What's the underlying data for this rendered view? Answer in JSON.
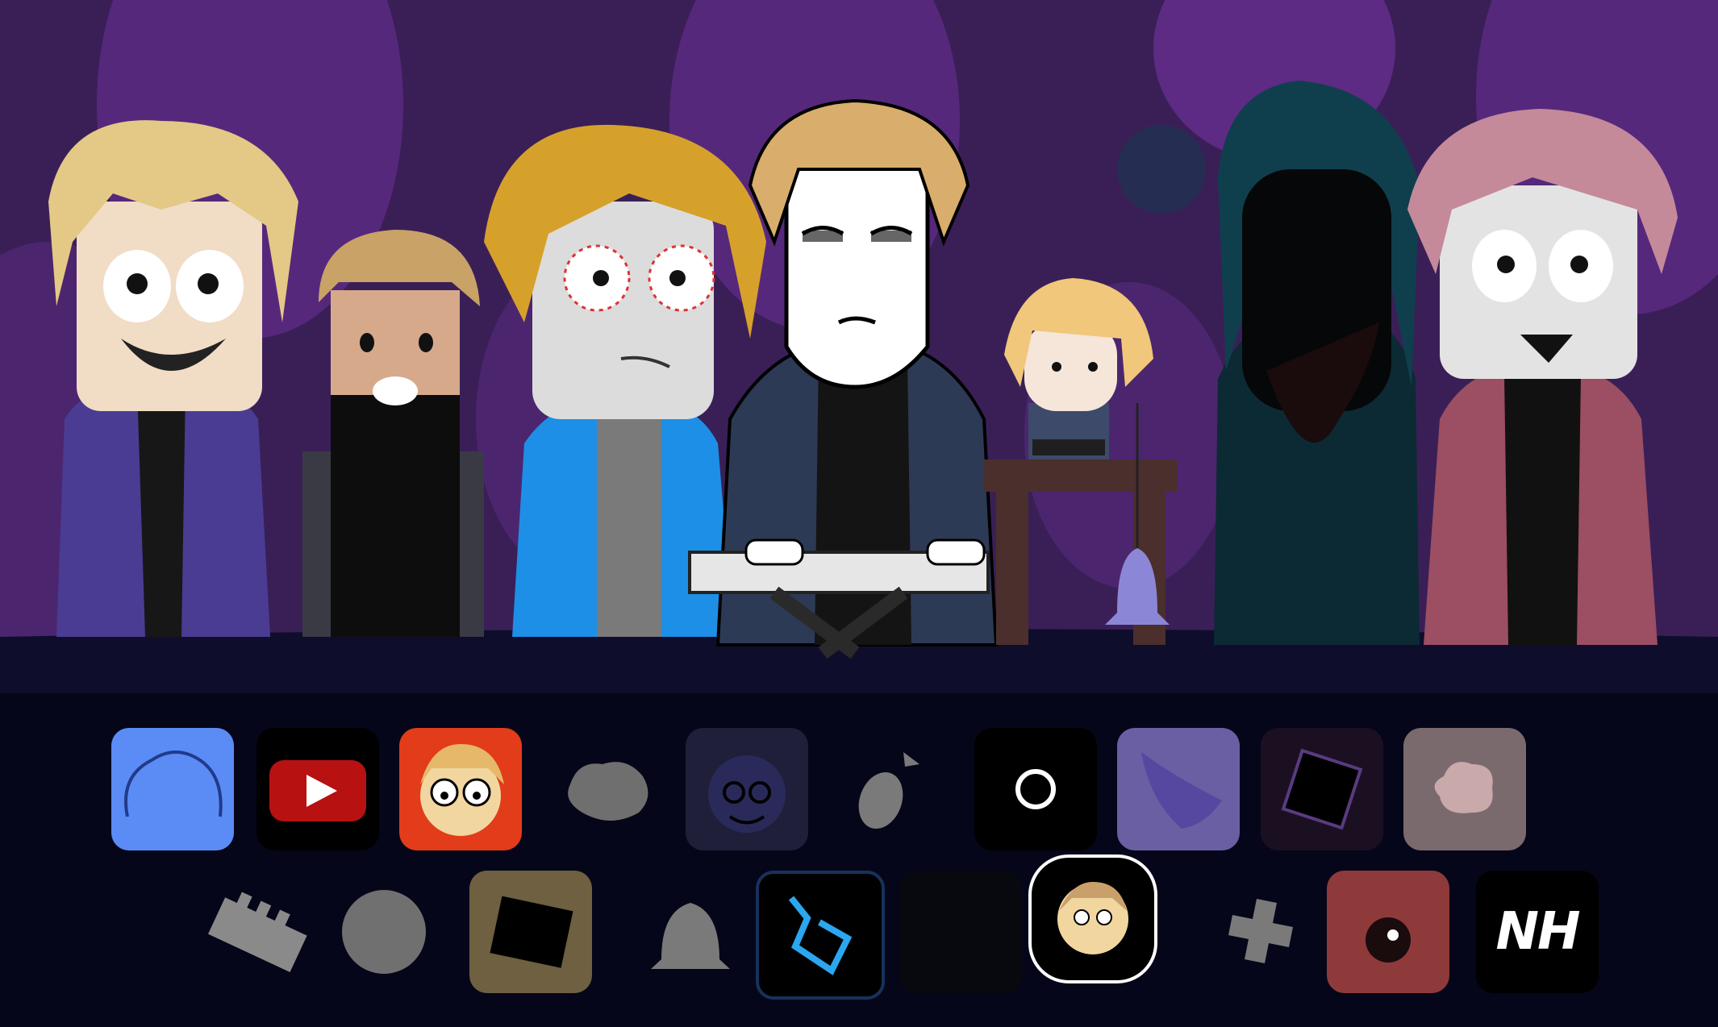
{
  "scene": {
    "background_color": "#3a1f57",
    "stage_floor_color": "#0e0e2c",
    "icon_tray_color": "#06061a",
    "characters": [
      {
        "name": "blonde-purple-coat-character",
        "hair": "#e3c985",
        "coat": "#4a3c93"
      },
      {
        "name": "blocky-brown-hair-character",
        "hair": "#c8a266",
        "coat": "#2c2c34"
      },
      {
        "name": "stitched-eyes-character",
        "hair": "#d6a12b",
        "coat": "#1e8fe6"
      },
      {
        "name": "tired-hoodie-keyboard-character",
        "hair": "#d9ad6b",
        "coat": "#2d3a55"
      },
      {
        "name": "small-bell-ringer-character",
        "hair": "#f0c77b",
        "coat": "#3d4a6a"
      },
      {
        "name": "shadow-teal-character",
        "hair": "#0f3f4d",
        "coat": "#0c2a33"
      },
      {
        "name": "pink-hair-character",
        "hair": "#c48a9a",
        "coat": "#9c4e62"
      }
    ]
  },
  "sound_icons": {
    "row1": [
      {
        "name": "blue-hair-sound-icon",
        "bg": "#5b8cf5"
      },
      {
        "name": "youtube-play-sound-icon",
        "bg": "#000000"
      },
      {
        "name": "cartoon-face-sound-icon",
        "bg": "#e23c1a"
      },
      {
        "name": "gray-bush-sound-icon",
        "bg": "transparent"
      },
      {
        "name": "dark-face-sound-icon",
        "bg": "#1f1f3a"
      },
      {
        "name": "seed-sound-icon",
        "bg": "transparent"
      },
      {
        "name": "circle-sound-icon",
        "bg": "#000000"
      },
      {
        "name": "purple-shape-sound-icon",
        "bg": "#6a5fa3"
      },
      {
        "name": "dark-square-sound-icon",
        "bg": "#1a1022"
      },
      {
        "name": "pink-blob-sound-icon",
        "bg": "#7a6a6e"
      }
    ],
    "row2": [
      {
        "name": "piano-keys-sound-icon",
        "bg": "transparent"
      },
      {
        "name": "spiky-ball-sound-icon",
        "bg": "transparent"
      },
      {
        "name": "tilted-square-sound-icon",
        "bg": "#6e6040"
      },
      {
        "name": "bell-sound-icon",
        "bg": "transparent"
      },
      {
        "name": "blue-scribble-sound-icon",
        "bg": "#000000"
      },
      {
        "name": "empty-sound-icon",
        "bg": "#08080f"
      },
      {
        "name": "portrait-frame-sound-icon",
        "bg": "#000000"
      },
      {
        "name": "cross-sound-icon",
        "bg": "transparent"
      },
      {
        "name": "red-skull-sound-icon",
        "bg": "#8e3a3a"
      },
      {
        "name": "nh-logo-sound-icon",
        "bg": "#000000"
      }
    ]
  },
  "nh_icon_text": "NH"
}
